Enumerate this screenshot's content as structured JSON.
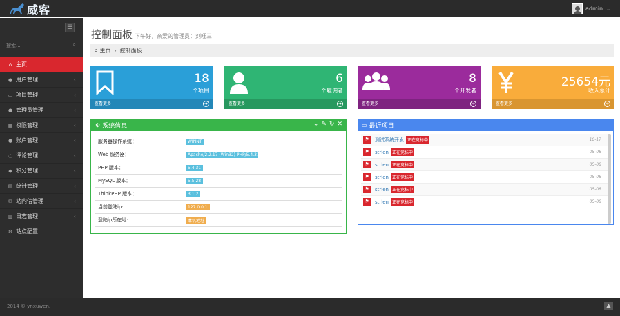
{
  "brand": {
    "name": "威客"
  },
  "user": {
    "name": "admin"
  },
  "sidebar": {
    "search_placeholder": "搜索...",
    "items": [
      {
        "label": "主页",
        "icon": "home-icon",
        "glyph": "⌂",
        "active": true
      },
      {
        "label": "用户管理",
        "icon": "user-icon",
        "glyph": "●"
      },
      {
        "label": "项目管理",
        "icon": "bookmark-icon",
        "glyph": "▭"
      },
      {
        "label": "管理员管理",
        "icon": "user-icon",
        "glyph": "●"
      },
      {
        "label": "权限管理",
        "icon": "sitemap-icon",
        "glyph": "▦"
      },
      {
        "label": "账户管理",
        "icon": "user-icon",
        "glyph": "●"
      },
      {
        "label": "评论管理",
        "icon": "comment-icon",
        "glyph": "◌"
      },
      {
        "label": "积分管理",
        "icon": "tag-icon",
        "glyph": "◆"
      },
      {
        "label": "统计管理",
        "icon": "chart-icon",
        "glyph": "▤"
      },
      {
        "label": "站内信管理",
        "icon": "envelope-icon",
        "glyph": "✉"
      },
      {
        "label": "日志管理",
        "icon": "calendar-icon",
        "glyph": "▥"
      },
      {
        "label": "站点配置",
        "icon": "cogs-icon",
        "glyph": "⚙"
      }
    ]
  },
  "page": {
    "title": "控制面板",
    "subtitle": "下午好，亲爱的管理员：刘旺三",
    "breadcrumb": {
      "home": "主页",
      "current": "控制面板"
    }
  },
  "stats": [
    {
      "value": "18",
      "label": "个项目",
      "more": "查看更多",
      "icon": "bookmark-icon",
      "color": "#2a9fd8"
    },
    {
      "value": "6",
      "label": "个雇佣者",
      "more": "查看更多",
      "icon": "user-icon",
      "color": "#2fb574"
    },
    {
      "value": "8",
      "label": "个开发者",
      "more": "查看更多",
      "icon": "users-icon",
      "color": "#9b2b9c"
    },
    {
      "value": "25654元",
      "label": "收入总计",
      "more": "查看更多",
      "icon": "yen-icon",
      "color": "#f9ac3b"
    }
  ],
  "system": {
    "title": "系统信息",
    "rows": [
      {
        "key": "服务器操作系统：",
        "value": "WINNT",
        "color": "blue"
      },
      {
        "key": "Web 服务器：",
        "value": "Apache/2.2.17 (Win32) PHP/5.4.31",
        "color": "blue"
      },
      {
        "key": "PHP 版本：",
        "value": "5.4.31",
        "color": "blue"
      },
      {
        "key": "MySQL 版本：",
        "value": "5.5.28",
        "color": "blue"
      },
      {
        "key": "ThinkPHP 版本：",
        "value": "3.1.2",
        "color": "blue"
      },
      {
        "key": "当前登陆ip:",
        "value": "127.0.0.1",
        "color": "orange"
      },
      {
        "key": "登陆ip所在地:",
        "value": "本机地址",
        "color": "orange"
      }
    ]
  },
  "recent": {
    "title": "最近项目",
    "items": [
      {
        "name": "测试系统开发",
        "status": "正在竞标中",
        "date": "10-17"
      },
      {
        "name": "strlen",
        "status": "正在竞标中",
        "date": "05-08"
      },
      {
        "name": "strlen",
        "status": "正在竞标中",
        "date": "05-08"
      },
      {
        "name": "strlen",
        "status": "正在竞标中",
        "date": "05-08"
      },
      {
        "name": "strlen",
        "status": "正在竞标中",
        "date": "05-08"
      },
      {
        "name": "strlen",
        "status": "正在竞标中",
        "date": "05-08"
      }
    ]
  },
  "footer": {
    "copyright": "2014 © ynxuwen."
  },
  "watermark": "https://www.huzhan.com/ishop18654"
}
